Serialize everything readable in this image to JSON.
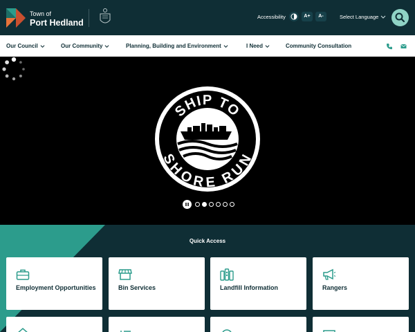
{
  "header": {
    "logo_small": "Town of",
    "logo_big": "Port Hedland",
    "accessibility_label": "Accessibility",
    "text_increase": "A+",
    "text_decrease": "A-",
    "language_label": "Select Language"
  },
  "nav": {
    "items": [
      {
        "label": "Our Council"
      },
      {
        "label": "Our Community"
      },
      {
        "label": "Planning, Building and Environment"
      },
      {
        "label": "I Need"
      },
      {
        "label": "Community Consultation"
      }
    ]
  },
  "hero": {
    "logo_text_top": "SHIP TO",
    "logo_text_bottom": "SHORE RUN",
    "slide_count": 6,
    "active_slide": 1
  },
  "quick_access": {
    "title": "Quick Access",
    "cards": [
      {
        "label": "Employment Opportunities",
        "icon": "briefcase-icon"
      },
      {
        "label": "Bin Services",
        "icon": "storefront-icon"
      },
      {
        "label": "Landfill Information",
        "icon": "bins-icon"
      },
      {
        "label": "Rangers",
        "icon": "megaphone-icon"
      }
    ]
  },
  "colors": {
    "brand_dark": "#0f2e35",
    "accent_teal": "#2c9c8c",
    "search_mint": "#8fd3c5",
    "logo_orange": "#e8733a"
  }
}
